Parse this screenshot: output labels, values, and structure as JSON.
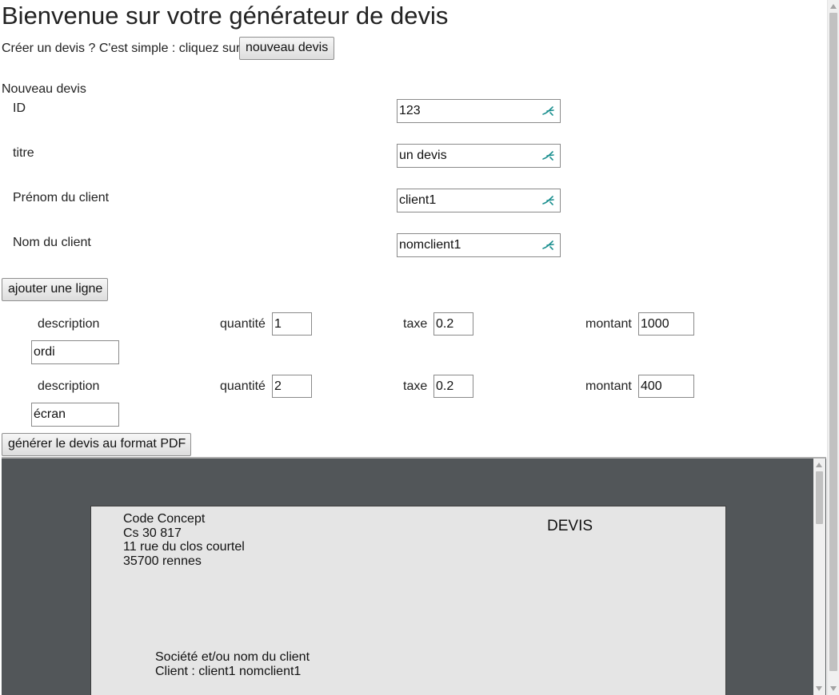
{
  "header": {
    "title": "Bienvenue sur votre générateur de devis",
    "intro": "Créer un devis ? C'est simple : cliquez sur",
    "new_button": "nouveau devis"
  },
  "form": {
    "section_title": "Nouveau devis",
    "fields": [
      {
        "label": "ID",
        "value": "123"
      },
      {
        "label": "titre",
        "value": "un devis"
      },
      {
        "label": "Prénom du client",
        "value": "client1"
      },
      {
        "label": "Nom du client",
        "value": "nomclient1"
      }
    ],
    "add_line_button": "ajouter une ligne",
    "line_labels": {
      "description": "description",
      "quantity": "quantité",
      "tax": "taxe",
      "amount": "montant"
    },
    "lines": [
      {
        "description": "ordi",
        "quantity": "1",
        "tax": "0.2",
        "amount": "1000"
      },
      {
        "description": "écran",
        "quantity": "2",
        "tax": "0.2",
        "amount": "400"
      }
    ],
    "generate_button": "générer le devis au format PDF"
  },
  "pdf": {
    "company": [
      "Code Concept",
      "Cs 30 817",
      "11 rue du clos courtel",
      "35700 rennes"
    ],
    "doc_title": "DEVIS",
    "client_heading": "Société et/ou nom du client",
    "client_line": "Client : client1 nomclient1"
  },
  "icons": {
    "field_keyboard": "keyboard-handwriting-icon"
  },
  "colors": {
    "icon_teal": "#1a8f8f",
    "viewer_bg": "#525659",
    "pdf_page_bg": "#e5e5e5"
  }
}
